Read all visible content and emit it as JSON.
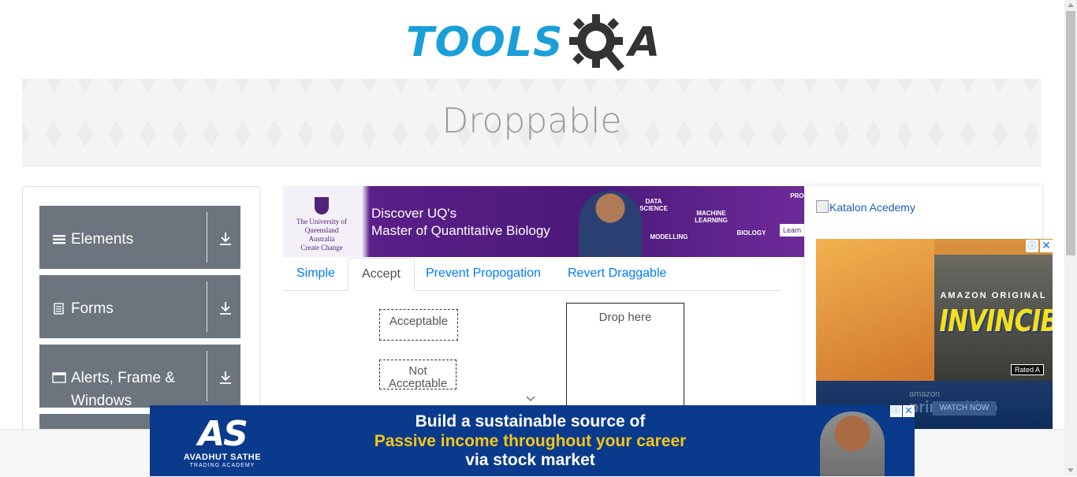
{
  "logo": {
    "text": "TOOLS",
    "suffix": "A"
  },
  "banner": {
    "title": "Droppable"
  },
  "sidebar": {
    "groups": [
      {
        "label": "Elements",
        "icon": "hamburger-icon"
      },
      {
        "label": "Forms",
        "icon": "document-icon"
      },
      {
        "label": "Alerts, Frame & Windows",
        "icon": "window-icon"
      }
    ]
  },
  "ad_top": {
    "brand": "The University of Queensland Australia",
    "tagline": "Create Change",
    "headline_1": "Discover UQ's",
    "headline_2": "Master of Quantitative Biology",
    "kw_1": "DATA SCIENCE",
    "kw_2": "MACHINE LEARNING",
    "kw_3": "MODELLING",
    "kw_4": "BIOLOGY",
    "kw_5": "PROG",
    "cta": "Learn"
  },
  "tabs": [
    {
      "label": "Simple",
      "active": false
    },
    {
      "label": "Accept",
      "active": true
    },
    {
      "label": "Prevent Propogation",
      "active": false
    },
    {
      "label": "Revert Draggable",
      "active": false
    }
  ],
  "accept": {
    "acceptable": "Acceptable",
    "not_acceptable": "Not Acceptable",
    "drop_target": "Drop here"
  },
  "right_ads": {
    "katalon_alt": "Katalon Acedemy",
    "amazon_original": "AMAZON ORIGINAL",
    "title": "INVINCIBLE",
    "rating": "Rated A",
    "amazon": "amazon",
    "prime": "prime video",
    "watch": "WATCH NOW"
  },
  "ad_bottom": {
    "brand_mark": "AS",
    "brand_name": "AVADHUT SATHE",
    "brand_sub": "TRADING ACADEMY",
    "line_1": "Build a sustainable source of",
    "line_2": "Passive income throughout your career",
    "line_3": "via stock market"
  },
  "colors": {
    "brand": "#1a9fd9",
    "sidebar": "#6c757d",
    "link": "#007bff"
  }
}
